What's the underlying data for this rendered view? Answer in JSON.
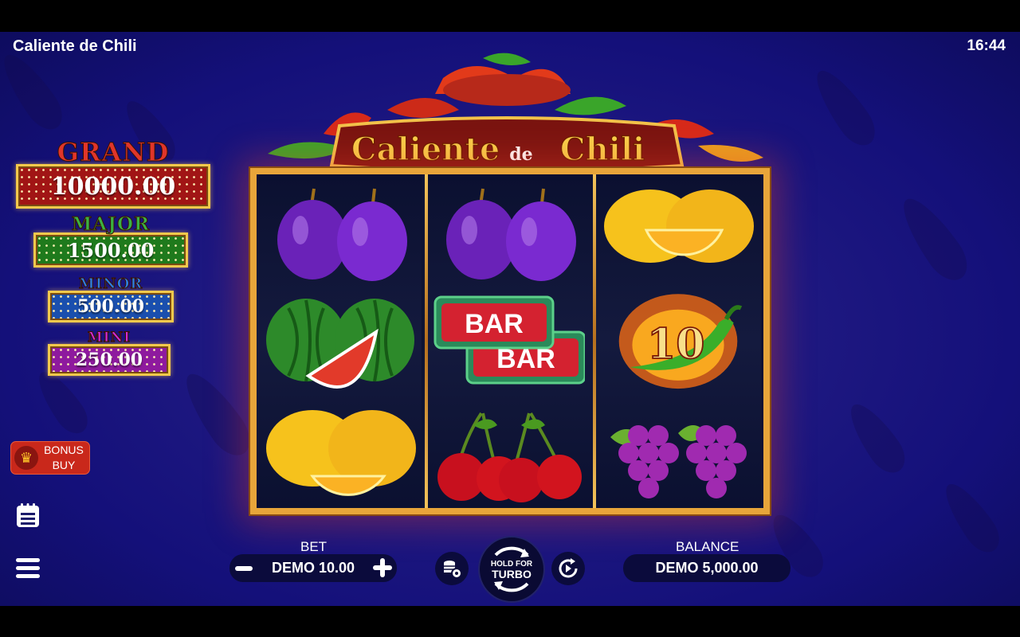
{
  "window": {
    "title": "Caliente de Chili",
    "clock": "16:44"
  },
  "logo": {
    "word1": "Caliente",
    "word2": "de",
    "word3": "Chili"
  },
  "jackpots": [
    {
      "name": "GRAND",
      "value": "10000.00",
      "title_color": "#e0352a",
      "box_color": "#a11515"
    },
    {
      "name": "MAJOR",
      "value": "1500.00",
      "title_color": "#3bb241",
      "box_color": "#1f7a1c"
    },
    {
      "name": "MINOR",
      "value": "500.00",
      "title_color": "#2d7ee0",
      "box_color": "#1a4fae"
    },
    {
      "name": "MINI",
      "value": "250.00",
      "title_color": "#d12ad6",
      "box_color": "#8e1a9e"
    }
  ],
  "bonus_buy": {
    "line1": "BONUS",
    "line2": "BUY",
    "icon": "crown-icon"
  },
  "side_icons": [
    "paytable-icon",
    "menu-icon"
  ],
  "reels": [
    [
      "plum",
      "watermelon",
      "lemon"
    ],
    [
      "plum",
      "bar",
      "cherry"
    ],
    [
      "lemon",
      "chili",
      "grapes"
    ]
  ],
  "chili_multiplier": "10",
  "bar_text": "BAR",
  "controls": {
    "bet_label": "BET",
    "bet_value": "DEMO 10.00",
    "minus": "minus-icon",
    "plus": "plus-icon",
    "settings_icon": "coins-settings-icon",
    "spin_line1": "HOLD FOR",
    "spin_line2": "TURBO",
    "autoplay_icon": "autoplay-icon",
    "balance_label": "BALANCE",
    "balance_value": "DEMO 5,000.00"
  }
}
